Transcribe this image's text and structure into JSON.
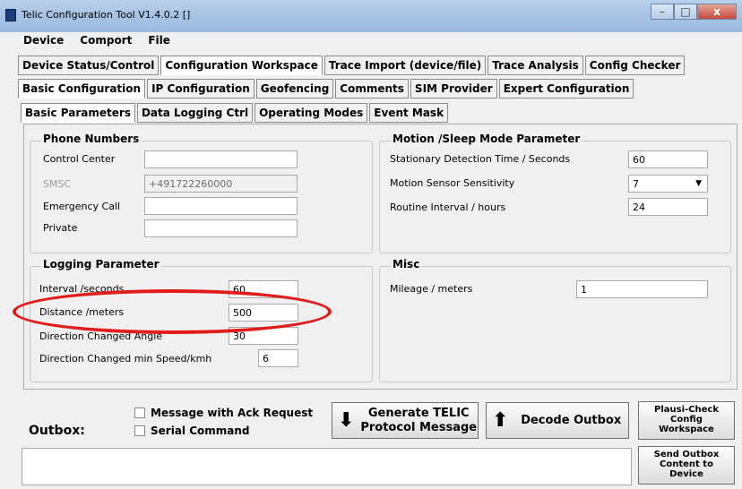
{
  "window": {
    "title": "Telic Configuration Tool V1.4.0.2 []"
  },
  "window_buttons": {
    "minimize": "–",
    "maximize": "□",
    "close": "x"
  },
  "menu": [
    "Device",
    "Comport",
    "File"
  ],
  "tabs_main": [
    {
      "label": "Device Status/Control",
      "active": false
    },
    {
      "label": "Configuration Workspace",
      "active": true
    },
    {
      "label": "Trace Import (device/file)",
      "active": false
    },
    {
      "label": "Trace Analysis",
      "active": false
    },
    {
      "label": "Config Checker",
      "active": false
    }
  ],
  "tabs_config": [
    {
      "label": "Basic Configuration",
      "active": true
    },
    {
      "label": "IP Configuration",
      "active": false
    },
    {
      "label": "Geofencing",
      "active": false
    },
    {
      "label": "Comments",
      "active": false
    },
    {
      "label": "SIM Provider",
      "active": false
    },
    {
      "label": "Expert Configuration",
      "active": false
    }
  ],
  "tabs_basic": [
    {
      "label": "Basic Parameters",
      "active": true
    },
    {
      "label": "Data Logging Ctrl",
      "active": false
    },
    {
      "label": "Operating Modes",
      "active": false
    },
    {
      "label": "Event Mask",
      "active": false
    }
  ],
  "phone_numbers": {
    "title": "Phone Numbers",
    "control_center": {
      "label": "Control Center",
      "value": ""
    },
    "smsc": {
      "label": "SMSC",
      "value": "+491722260000"
    },
    "emergency_call": {
      "label": "Emergency Call",
      "value": ""
    },
    "private": {
      "label": "Private",
      "value": ""
    }
  },
  "motion": {
    "title": "Motion /Sleep Mode Parameter",
    "stationary": {
      "label": "Stationary Detection Time / Seconds",
      "value": "60"
    },
    "sensitivity": {
      "label": "Motion Sensor Sensitivity",
      "value": "7"
    },
    "routine": {
      "label": "Routine Interval / hours",
      "value": "24"
    }
  },
  "logging": {
    "title": "Logging Parameter",
    "interval": {
      "label": "Interval /seconds",
      "value": "60"
    },
    "distance": {
      "label": "Distance /meters",
      "value": "500"
    },
    "direction_angle": {
      "label": "Direction Changed Angle",
      "value": "30"
    },
    "direction_speed": {
      "label": "Direction Changed min Speed/kmh",
      "value": "6"
    }
  },
  "misc": {
    "title": "Misc",
    "mileage": {
      "label": "Mileage / meters",
      "value": "1"
    }
  },
  "bottom": {
    "outbox_label": "Outbox:",
    "ack_request": "Message with Ack Request",
    "serial_command": "Serial Command",
    "generate_btn_line1": "Generate TELIC",
    "generate_btn_line2": "Protocol Message",
    "decode_btn": "Decode Outbox",
    "plausi_line1": "Plausi-Check",
    "plausi_line2": "Config",
    "plausi_line3": "Workspace",
    "send_line1": "Send Outbox",
    "send_line2": "Content to",
    "send_line3": "Device",
    "outbox_text": ""
  },
  "annotation": {
    "color": "#e21b1b",
    "highlights": "Distance /meters"
  }
}
